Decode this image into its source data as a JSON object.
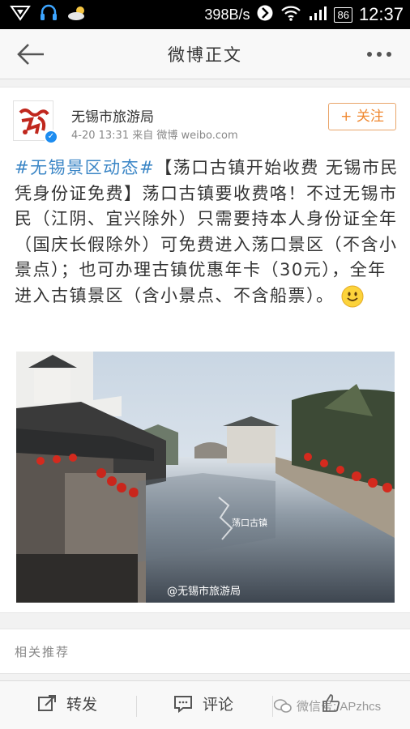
{
  "status_bar": {
    "speed": "398B/s",
    "battery": "86",
    "time": "12:37"
  },
  "nav": {
    "title": "微博正文"
  },
  "post": {
    "author": "无锡市旅游局",
    "timestamp": "4-20 13:31",
    "source": "来自 微博 weibo.com",
    "follow_label": "+ 关注",
    "topic": "#无锡景区动态#",
    "body": "【荡口古镇开始收费 无锡市民凭身份证免费】荡口古镇要收费咯！不过无锡市民（江阴、宜兴除外）只需要持本人身份证全年（国庆长假除外）可免费进入荡口景区（不含小景点）；也可办理古镇优惠年卡（30元），全年进入古镇景区（含小景点、不含船票）。",
    "image_watermark": "@无锡市旅游局"
  },
  "related": {
    "label": "相关推荐"
  },
  "bottom_bar": {
    "repost_label": "转发",
    "comment_label": "评论",
    "wechat_watermark": "微信号: APzhcs"
  },
  "colors": {
    "accent": "#f08830",
    "link": "#3b86c6",
    "verified": "#1d8cf0"
  }
}
